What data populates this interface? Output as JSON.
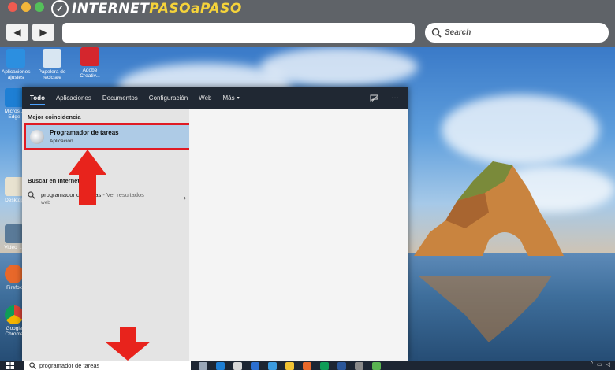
{
  "site": {
    "brand_prefix": "INTERNET",
    "brand_accent": "PASO",
    "brand_mid": "a",
    "brand_suffix": "PASO"
  },
  "browser": {
    "back_icon": "back-arrow-icon",
    "forward_icon": "forward-arrow-icon",
    "url_value": "",
    "search_placeholder": "Search"
  },
  "desktop": {
    "icons": [
      {
        "label": "Aplicaciones ajustes"
      },
      {
        "label": "Papelera de reciclaje"
      },
      {
        "label": "Adobe Creativ..."
      },
      {
        "label": "Micros... Edge"
      },
      {
        "label": "Desktop"
      },
      {
        "label": "Video_..."
      },
      {
        "label": "Firefox"
      },
      {
        "label": "Google Chrome"
      }
    ]
  },
  "start_menu": {
    "tabs": [
      {
        "label": "Todo",
        "active": true
      },
      {
        "label": "Aplicaciones"
      },
      {
        "label": "Documentos"
      },
      {
        "label": "Configuración"
      },
      {
        "label": "Web"
      },
      {
        "label": "Más"
      }
    ],
    "more_caret": "▾",
    "feedback_icon": "feedback-icon",
    "more_options": "···",
    "best_match_heading": "Mejor coincidencia",
    "best_match": {
      "title": "Programador de tareas",
      "subtitle": "Aplicación"
    },
    "web_heading": "Buscar en Internet",
    "web_result": {
      "query": "programador de tareas",
      "suffix": " - Ver resultados",
      "sub": "web"
    }
  },
  "taskbar": {
    "search_value": "programador de tareas",
    "tray_chevron": "^"
  },
  "colors": {
    "highlight": "#e01b24",
    "selection": "#aecbe6",
    "tab_underline": "#4da3ff"
  }
}
